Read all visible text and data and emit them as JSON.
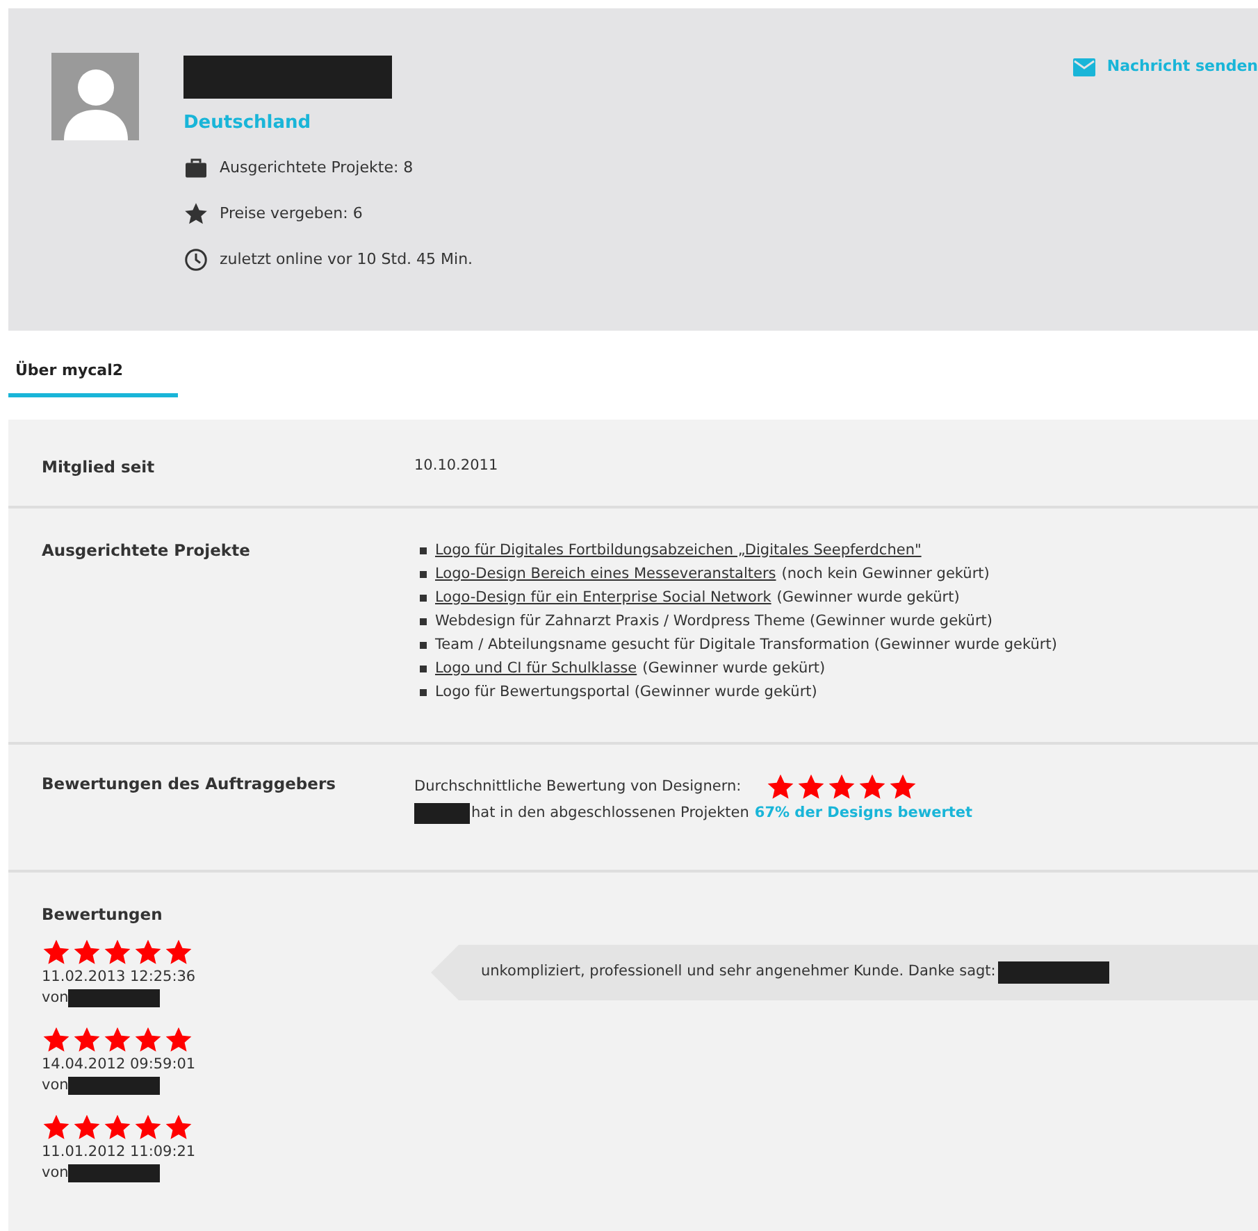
{
  "profile": {
    "country": "Deutschland",
    "stats": [
      {
        "kind": "briefcase",
        "text": "Ausgerichtete Projekte: 8"
      },
      {
        "kind": "star",
        "text": "Preise vergeben: 6"
      },
      {
        "kind": "clock",
        "text": "zuletzt online vor 10 Std. 45 Min."
      }
    ],
    "message_button": "Nachricht senden"
  },
  "tabs": [
    {
      "label": "Über mycal2",
      "selected": true
    }
  ],
  "member_since": {
    "label": "Mitglied seit",
    "value": "10.10.2011"
  },
  "projects": {
    "label": "Ausgerichtete Projekte",
    "items": [
      {
        "title": "Logo für Digitales Fortbildungsabzeichen „Digitales Seepferdchen\"",
        "linked": true
      },
      {
        "title": "Logo-Design Bereich eines Messeveranstalters",
        "linked": true,
        "status": "(noch kein Gewinner gekürt)"
      },
      {
        "title": "Logo-Design für ein Enterprise Social Network",
        "linked": true,
        "status": "(Gewinner wurde gekürt)"
      },
      {
        "title": "Webdesign für Zahnarzt Praxis / Wordpress Theme",
        "linked": false,
        "status": "(Gewinner wurde gekürt)"
      },
      {
        "title": "Team / Abteilungsname gesucht für Digitale Transformation",
        "linked": false,
        "status": "(Gewinner wurde gekürt)"
      },
      {
        "title": "Logo und CI für Schulklasse",
        "linked": true,
        "status": "(Gewinner wurde gekürt)"
      },
      {
        "title": "Logo für Bewertungsportal",
        "linked": false,
        "status": "(Gewinner wurde gekürt)"
      }
    ]
  },
  "client_rating": {
    "label": "Bewertungen des Auftraggebers",
    "average_label": "Durchschnittliche Bewertung von Designern:",
    "stars": 5,
    "text": "hat in den abgeschlossenen Projekten",
    "link": "67% der Designs bewertet"
  },
  "reviews": {
    "label": "Bewertungen",
    "items": [
      {
        "stars": 5,
        "date": "11.02.2013 12:25:36",
        "by": "von",
        "comment": "unkompliziert, professionell und sehr angenehmer Kunde. Danke sagt:"
      },
      {
        "stars": 5,
        "date": "14.04.2012 09:59:01",
        "by": "von"
      },
      {
        "stars": 5,
        "date": "11.01.2012 11:09:21",
        "by": "von"
      }
    ]
  }
}
